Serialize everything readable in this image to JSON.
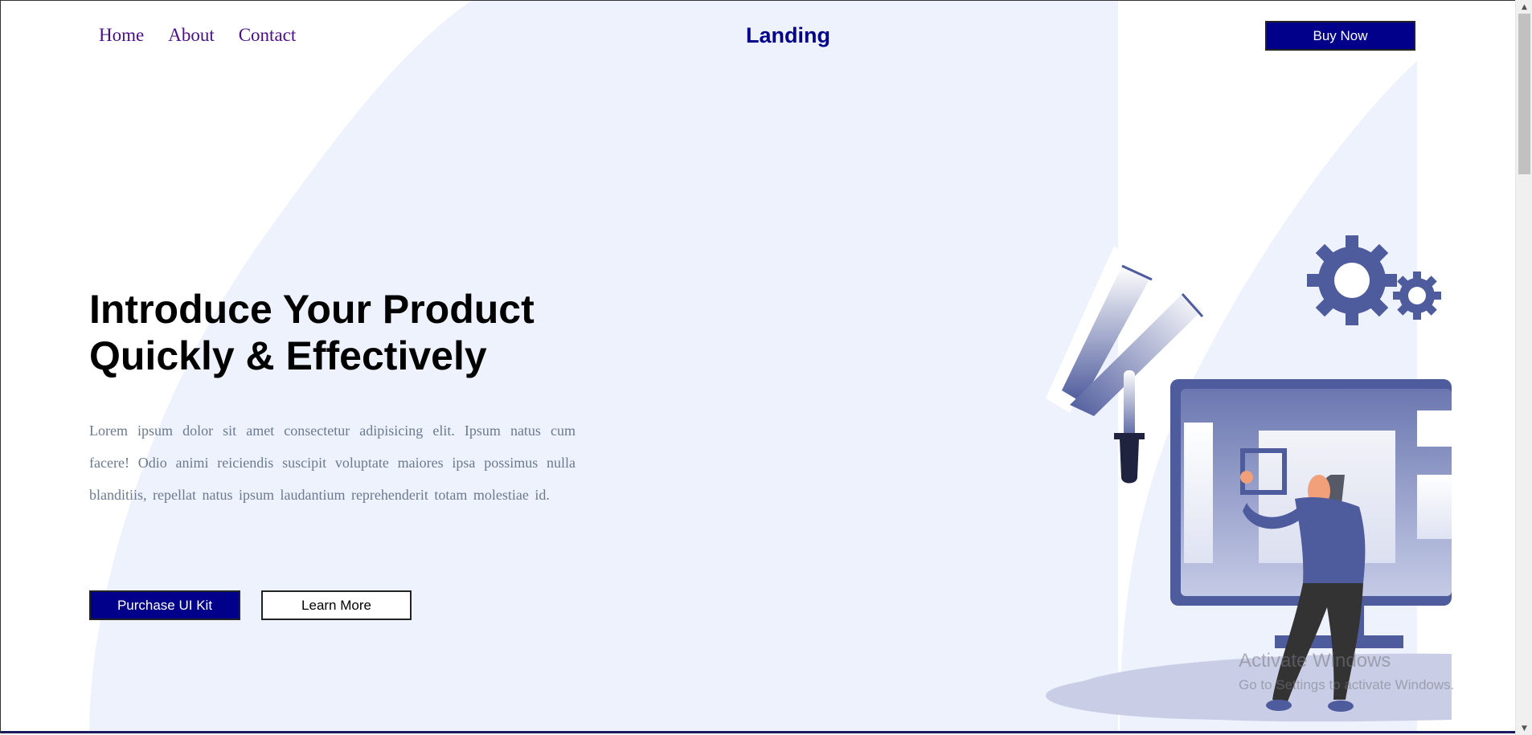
{
  "nav": {
    "links": [
      "Home",
      "About",
      "Contact"
    ],
    "brand": "Landing",
    "buy_label": "Buy Now"
  },
  "hero": {
    "title_line1": "Introduce Your Product",
    "title_line2": "Quickly & Effectively",
    "body": "Lorem ipsum dolor sit amet consectetur adipisicing elit. Ipsum natus cum facere! Odio animi reiciendis suscipit voluptate maiores ipsa possimus nulla blanditiis, repellat natus ipsum laudantium reprehenderit totam molestiae id.",
    "primary_cta": "Purchase UI Kit",
    "secondary_cta": "Learn More"
  },
  "watermark": {
    "title": "Activate Windows",
    "subtitle": "Go to Settings to activate Windows."
  },
  "icons": {
    "illustration": "designer-at-monitor-illustration",
    "scroll_up": "scroll-up-arrow-icon",
    "scroll_down": "scroll-down-arrow-icon"
  },
  "colors": {
    "primary": "#00008b",
    "nav_link": "#4b0f8a",
    "hero_bg": "#eef2fd",
    "illustration_accent": "#4e5b9c"
  }
}
